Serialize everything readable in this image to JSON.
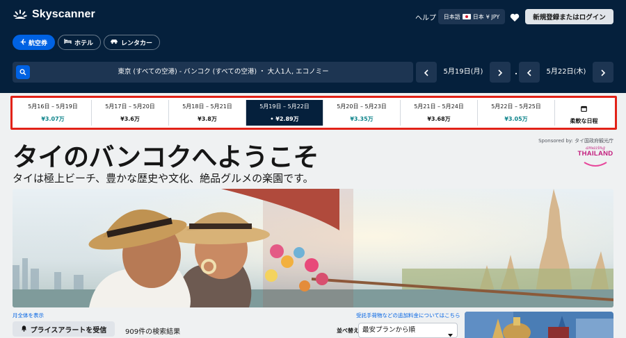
{
  "header": {
    "brand": "Skyscanner",
    "help_label": "ヘルプ",
    "locale": {
      "language": "日本語",
      "country": "日本",
      "currency": "¥ JPY"
    },
    "login_label": "新規登録またはログイン",
    "heart_icon": "heart-icon"
  },
  "tabs": [
    {
      "label": "航空券",
      "icon": "plane-icon",
      "active": true
    },
    {
      "label": "ホテル",
      "icon": "bed-icon",
      "active": false
    },
    {
      "label": "レンタカー",
      "icon": "car-icon",
      "active": false
    }
  ],
  "search": {
    "summary": "東京 (すべての空港) - バンコク (すべての空港) ・ 大人1人, エコノミー",
    "depart_date": "5月19日(月)",
    "return_date": "5月22日(木)",
    "separator": "・"
  },
  "date_strip": {
    "cells": [
      {
        "dates": "5月16日 – 5月19日",
        "price": "¥3.07万",
        "cheap": true,
        "selected": false
      },
      {
        "dates": "5月17日 – 5月20日",
        "price": "¥3.6万",
        "cheap": false,
        "selected": false
      },
      {
        "dates": "5月18日 – 5月21日",
        "price": "¥3.8万",
        "cheap": false,
        "selected": false
      },
      {
        "dates": "5月19日 – 5月22日",
        "price": "• ¥2.89万",
        "cheap": false,
        "selected": true
      },
      {
        "dates": "5月20日 – 5月23日",
        "price": "¥3.35万",
        "cheap": true,
        "selected": false
      },
      {
        "dates": "5月21日 – 5月24日",
        "price": "¥3.68万",
        "cheap": false,
        "selected": false
      },
      {
        "dates": "5月22日 – 5月25日",
        "price": "¥3.05万",
        "cheap": true,
        "selected": false
      }
    ],
    "flexible_label": "柔軟な日程"
  },
  "hero": {
    "title": "タイのバンコクへようこそ",
    "subtitle": "タイは極上ビーチ、豊かな歴史や文化、絶品グルメの楽園です。",
    "sponsored": "Sponsored by: タイ国政府観光庁",
    "sponsor_logo_top": "amazing",
    "sponsor_logo_main": "THAILAND"
  },
  "results": {
    "month_link": "月全体を表示",
    "fees_link": "受託手荷物などの追加料金についてはこちら",
    "alert_label": "プライスアラートを受信",
    "count": "909件の検索結果",
    "sort_label": "並べ替え",
    "sort_value": "最安プランから順"
  },
  "colors": {
    "header_bg": "#05203c",
    "accent": "#0062e3",
    "cheap_price": "#0c838a",
    "highlight_border": "#e22218"
  }
}
